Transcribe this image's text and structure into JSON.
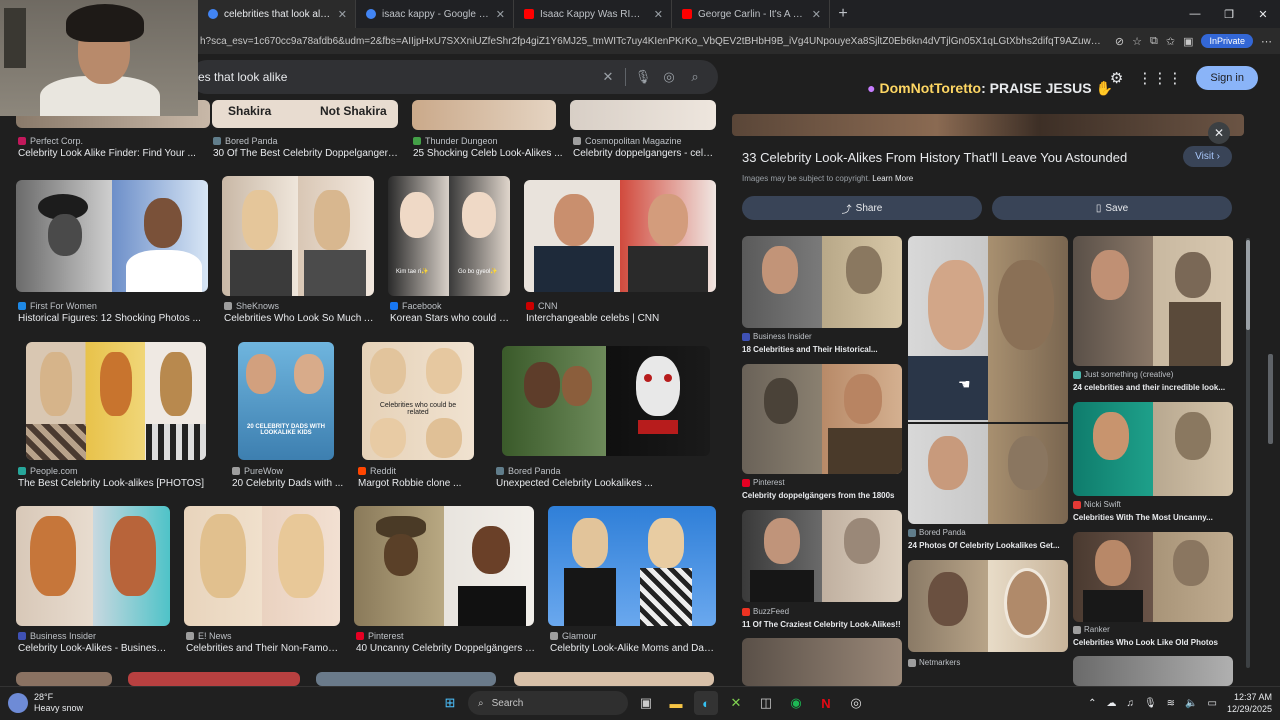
{
  "tabs": [
    {
      "title": "celebrities that look alike - Google",
      "icon": "google-icon",
      "color": "#4285f4",
      "active": true
    },
    {
      "title": "isaac kappy - Google Search",
      "icon": "google-icon",
      "color": "#4285f4",
      "active": false
    },
    {
      "title": "Isaac Kappy Was RIGHT! Tom Han",
      "icon": "youtube-icon",
      "color": "#ff0000",
      "active": false
    },
    {
      "title": "George Carlin - It's A BIG Club & Y",
      "icon": "youtube-icon",
      "color": "#ff0000",
      "active": false
    }
  ],
  "address": {
    "url": "h?sca_esv=1c670cc9a78afdb6&udm=2&fbs=AIIjpHxU7SXXniUZfeShr2fp4giZ1Y6MJ25_tmWITc7uy4KIenPKrKo_VbQEV2tBHbH9B_iVg4UNpouyeXa8SjltZ0Eb6kn4dVTjlGn05X1qLGtXbhs2difqT9AZuwQejEOJaaYZVfSzZMNS...",
    "inprivate_label": "InPrivate"
  },
  "search": {
    "query": "es that look alike"
  },
  "header": {
    "notice_name": "DomNotToretto",
    "notice_text": ": PRAISE JESUS",
    "signin_label": "Sign in"
  },
  "results": [
    {
      "source": "Perfect Corp.",
      "caption": "Celebrity Look Alike Finder: Find Your ...",
      "color": "#c2185b"
    },
    {
      "source": "Bored Panda",
      "caption": "30 Of The Best Celebrity Doppelgangers ...",
      "color": "#607d8b"
    },
    {
      "source": "Thunder Dungeon",
      "caption": "25 Shocking Celeb Look-Alikes ...",
      "color": "#43a047"
    },
    {
      "source": "Cosmopolitan Magazine",
      "caption": "Celebrity doppelgangers - celeb...",
      "color": "#9e9e9e"
    },
    {
      "source": "First For Women",
      "caption": "Historical Figures: 12 Shocking Photos ...",
      "color": "#1e88e5"
    },
    {
      "source": "SheKnows",
      "caption": "Celebrities Who Look So Much A...",
      "color": "#9e9e9e"
    },
    {
      "source": "Facebook",
      "caption": "Korean Stars who could b...",
      "color": "#1877f2"
    },
    {
      "source": "CNN",
      "caption": "Interchangeable celebs | CNN",
      "color": "#cc0000"
    },
    {
      "source": "People.com",
      "caption": "The Best Celebrity Look-alikes [PHOTOS]",
      "color": "#26a69a"
    },
    {
      "source": "PureWow",
      "caption": "20 Celebrity Dads with ...",
      "color": "#9e9e9e"
    },
    {
      "source": "Reddit",
      "caption": "Margot Robbie clone ...",
      "color": "#ff4500"
    },
    {
      "source": "Bored Panda",
      "caption": "Unexpected Celebrity Lookalikes ...",
      "color": "#607d8b"
    },
    {
      "source": "Business Insider",
      "caption": "Celebrity Look-Alikes - Business I...",
      "color": "#3f51b5"
    },
    {
      "source": "E! News",
      "caption": "Celebrities and Their Non-Famous...",
      "color": "#9e9e9e"
    },
    {
      "source": "Pinterest",
      "caption": "40 Uncanny Celebrity Doppelgängers Fr...",
      "color": "#e60023"
    },
    {
      "source": "Glamour",
      "caption": "Celebrity Look-Alike Moms and Daug...",
      "color": "#9e9e9e"
    }
  ],
  "image_text": {
    "shakira": "Shakira",
    "not_shakira": "Not Shakira",
    "korean_left": "Kim tae ri✨",
    "korean_right": "Go bo gyeol✨",
    "dads": "20 CELEBRITY DADS WITH LOOKALIKE KIDS",
    "related": "Celebrities who could be related"
  },
  "panel": {
    "title": "33 Celebrity Look-Alikes From History That'll Leave You Astounded",
    "visit_label": "Visit",
    "copyright_text": "Images may be subject to copyright.",
    "learn_more": "Learn More",
    "share_label": "Share",
    "save_label": "Save",
    "related": [
      {
        "source": "Business Insider",
        "caption": "18 Celebrities and Their Historical...",
        "color": "#3f51b5"
      },
      {
        "source": "Pinterest",
        "caption": "Celebrity doppelgängers from the 1800s",
        "color": "#e60023"
      },
      {
        "source": "BuzzFeed",
        "caption": "11 Of The Craziest Celebrity Look-Alikes!!",
        "color": "#ee3322"
      },
      {
        "source": "Bored Panda",
        "caption": "24 Photos Of Celebrity Lookalikes Get...",
        "color": "#607d8b"
      },
      {
        "source": "Netmarkers",
        "caption": "",
        "color": "#9e9e9e"
      },
      {
        "source": "Just something (creative)",
        "caption": "24 celebrities and their incredible look...",
        "color": "#4db6ac"
      },
      {
        "source": "Nicki Swift",
        "caption": "Celebrities With The Most Uncanny...",
        "color": "#e53935"
      },
      {
        "source": "Ranker",
        "caption": "Celebrities Who Look Like Old Photos",
        "color": "#9e9e9e"
      }
    ]
  },
  "taskbar": {
    "temp": "28°F",
    "weather": "Heavy snow",
    "search_label": "Search",
    "time": "12:37 AM",
    "date": "12/29/2025"
  }
}
